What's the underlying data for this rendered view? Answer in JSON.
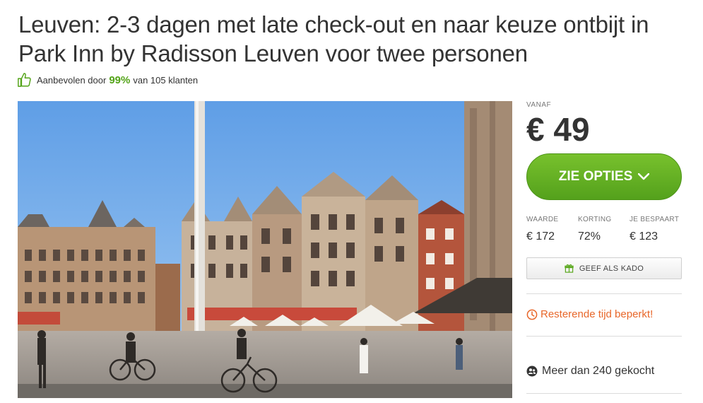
{
  "deal": {
    "title": "Leuven: 2-3 dagen met late check-out en naar keuze ontbijt in Park Inn by Radisson Leuven voor twee personen",
    "rating": {
      "prefix": "Aanbevolen door",
      "percent": "99%",
      "suffix": "van 105 klanten"
    }
  },
  "photo": {
    "alt": "Grote Markt Leuven"
  },
  "pricing": {
    "from_label": "VANAF",
    "price": "€ 49",
    "cta_label": "ZIE OPTIES",
    "stats": [
      {
        "label": "WAARDE",
        "value": "€ 172"
      },
      {
        "label": "KORTING",
        "value": "72%"
      },
      {
        "label": "JE BESPAART",
        "value": "€ 123"
      }
    ],
    "gift_label": "GEEF ALS KADO",
    "time_notice": "Resterende tijd beperkt!",
    "sold_text": "Meer dan 240 gekocht"
  },
  "colors": {
    "green": "#5aa81e",
    "orange": "#e8672a",
    "pct_green": "#53a318"
  },
  "icons": {
    "rating": "thumbs-up-icon",
    "cta": "chevron-down-icon",
    "gift": "gift-icon",
    "timer": "clock-icon",
    "sold": "users-icon"
  }
}
